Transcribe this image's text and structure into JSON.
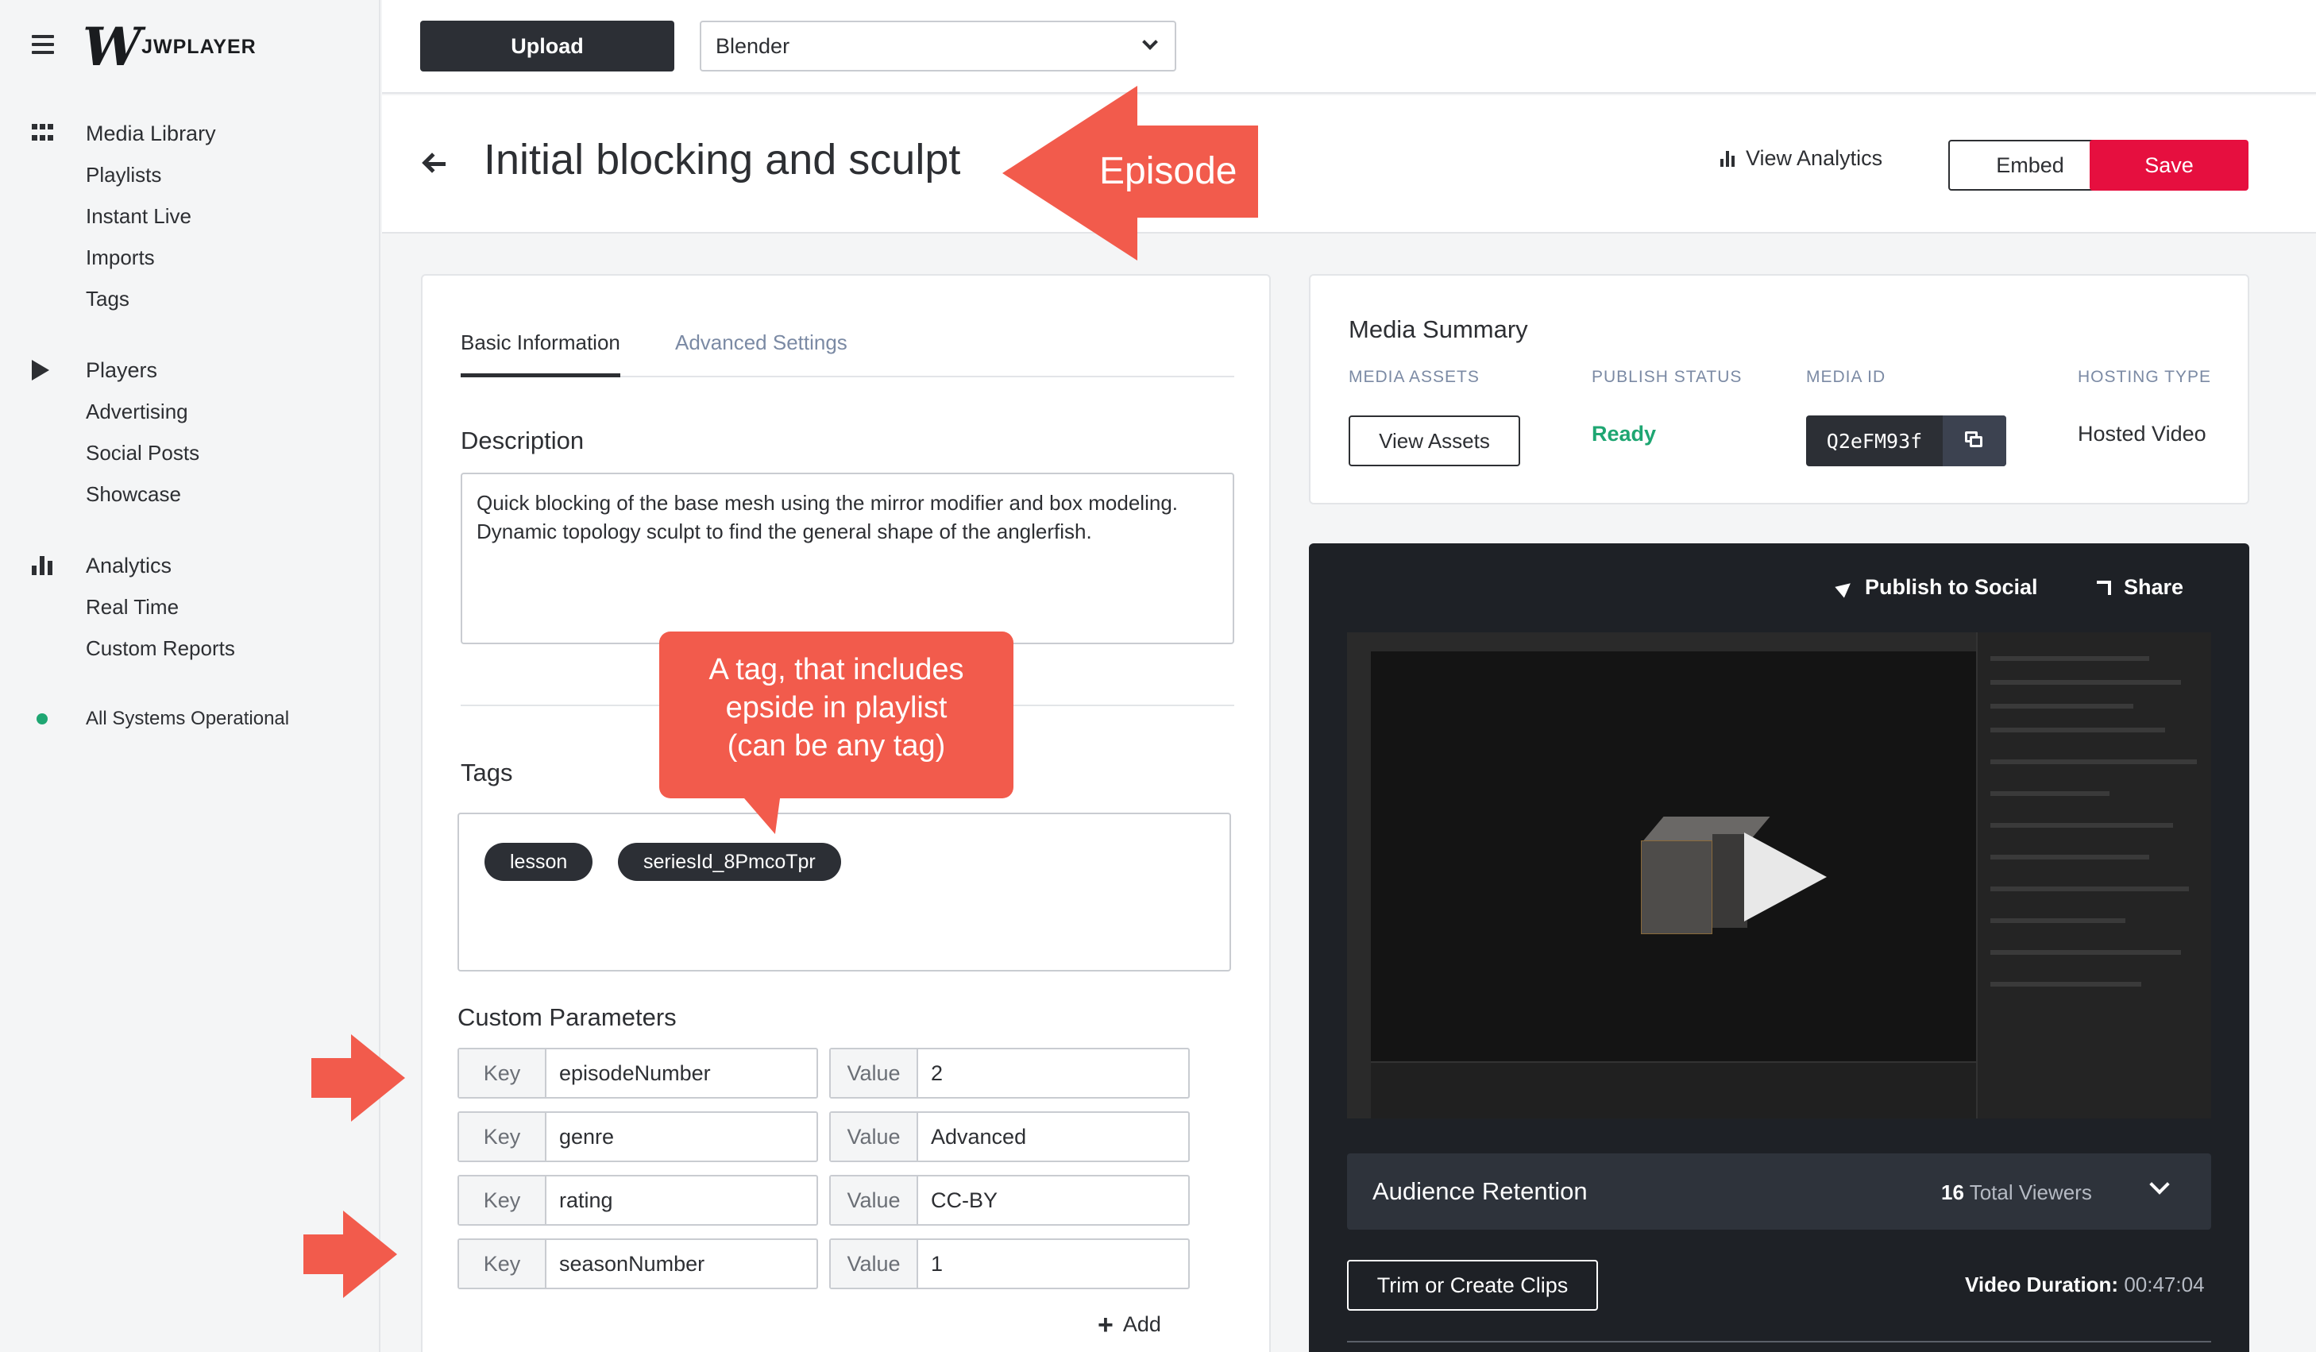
{
  "app": {
    "brand": "JWPLAYER"
  },
  "sidebar": {
    "sections": [
      {
        "icon": "grid-icon",
        "items": [
          "Media Library",
          "Playlists",
          "Instant Live",
          "Imports",
          "Tags"
        ]
      },
      {
        "icon": "play-icon",
        "items": [
          "Players",
          "Advertising",
          "Social Posts",
          "Showcase"
        ]
      },
      {
        "icon": "bar-chart-icon",
        "items": [
          "Analytics",
          "Real Time",
          "Custom Reports"
        ]
      }
    ],
    "status": "All Systems Operational",
    "status_color": "#1ea672"
  },
  "topbar": {
    "upload_label": "Upload",
    "property": "Blender"
  },
  "header": {
    "title": "Initial blocking and sculpt",
    "view_analytics": "View Analytics",
    "embed": "Embed",
    "save": "Save",
    "save_color": "#e60f3f"
  },
  "details": {
    "tabs": [
      "Basic Information",
      "Advanced Settings"
    ],
    "description_label": "Description",
    "description": "Quick blocking of the base mesh using the mirror modifier and box modeling. Dynamic topology sculpt to find the general shape of the anglerfish.",
    "tags_label": "Tags",
    "tags": [
      "lesson",
      "seriesId_8PmcoTpr"
    ],
    "custom_params_label": "Custom Parameters",
    "key_label": "Key",
    "value_label": "Value",
    "params": [
      {
        "key": "episodeNumber",
        "value": "2"
      },
      {
        "key": "genre",
        "value": "Advanced"
      },
      {
        "key": "rating",
        "value": "CC-BY"
      },
      {
        "key": "seasonNumber",
        "value": "1"
      }
    ],
    "add": "Add"
  },
  "summary": {
    "title": "Media Summary",
    "col_assets": "MEDIA ASSETS",
    "col_status": "PUBLISH STATUS",
    "col_id": "MEDIA ID",
    "col_hosting": "HOSTING TYPE",
    "view_assets": "View Assets",
    "status": "Ready",
    "media_id": "Q2eFM93f",
    "hosting": "Hosted Video"
  },
  "player": {
    "publish_social": "Publish to Social",
    "share": "Share",
    "audience_title": "Audience Retention",
    "viewers_count": "16",
    "viewers_label": "Total Viewers",
    "trim": "Trim or Create Clips",
    "duration_label": "Video Duration:",
    "duration": "00:47:04"
  },
  "annotations": {
    "episode": "Episode",
    "tag_note": [
      "A tag, that includes",
      "epside in playlist",
      "(can be any tag)"
    ],
    "color": "#f25b4c"
  }
}
